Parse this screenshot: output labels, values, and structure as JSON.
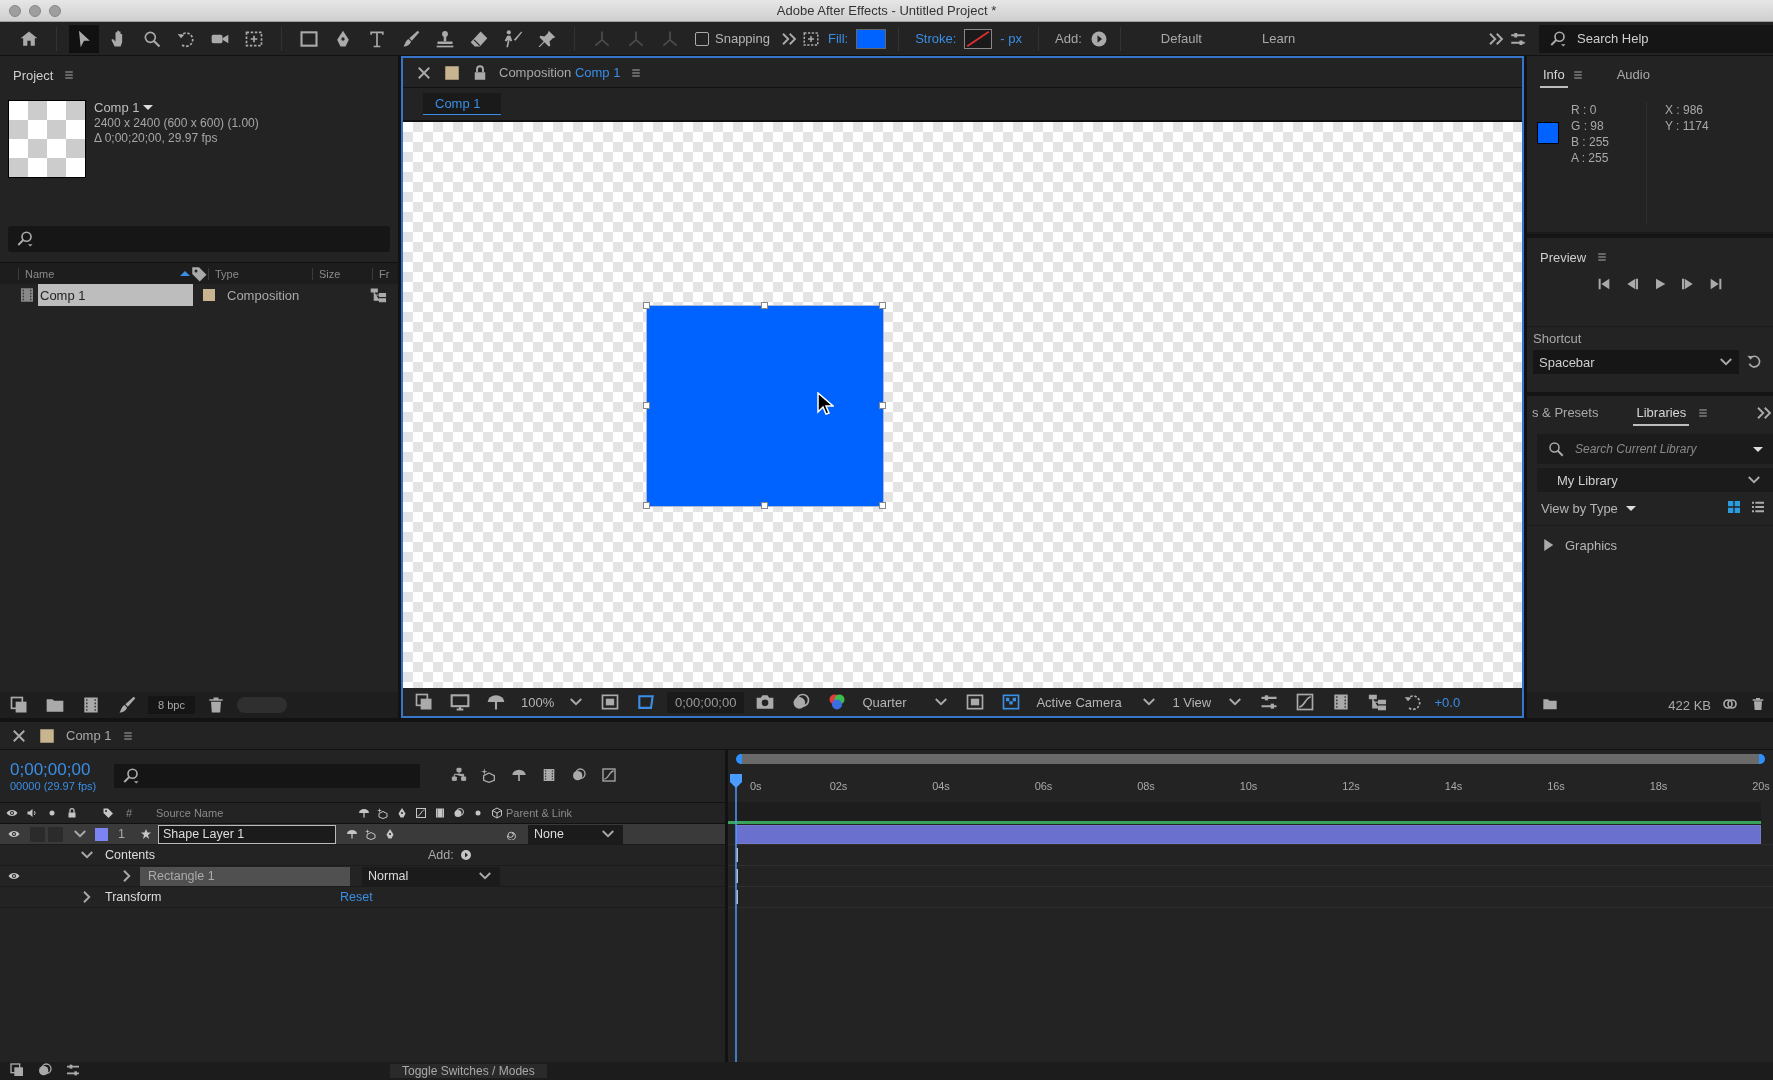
{
  "window": {
    "title": "Adobe After Effects - Untitled Project *"
  },
  "toolbar": {
    "tools": [
      {
        "kind": "home",
        "selected": false
      },
      {
        "kind": "select",
        "selected": true
      },
      {
        "kind": "hand",
        "selected": false
      },
      {
        "kind": "zoom",
        "selected": false
      },
      {
        "kind": "rotate",
        "selected": false
      },
      {
        "kind": "camera",
        "selected": false
      },
      {
        "kind": "pan",
        "selected": false
      },
      {
        "kind": "rectangle",
        "selected": false
      },
      {
        "kind": "pen",
        "selected": false
      },
      {
        "kind": "type",
        "selected": false
      },
      {
        "kind": "brush",
        "selected": false
      },
      {
        "kind": "stamp",
        "selected": false
      },
      {
        "kind": "eraser",
        "selected": false
      },
      {
        "kind": "roto",
        "selected": false
      },
      {
        "kind": "pin",
        "selected": false
      }
    ],
    "axis_modes": [
      {
        "disabled": true
      },
      {
        "disabled": true
      },
      {
        "disabled": true
      }
    ],
    "snapping": {
      "label": "Snapping",
      "checked": false
    },
    "fill_label": "Fill:",
    "stroke_label": "Stroke:",
    "stroke_width": "- px",
    "add_label": "Add:",
    "workspaces": [
      "Default",
      "Learn"
    ],
    "search": {
      "placeholder": "Search Help"
    }
  },
  "project": {
    "title": "Project",
    "comp_name": "Comp 1",
    "comp_size": "2400 x 2400  (600 x 600) (1.00)",
    "comp_duration": "Δ 0;00;20;00, 29.97 fps",
    "columns": [
      "Name",
      "Type",
      "Size",
      "Fr"
    ],
    "items": [
      {
        "name": "Comp 1",
        "type": "Composition",
        "selected": true
      }
    ],
    "bpc": "8 bpc"
  },
  "viewer": {
    "tab_label": "Composition",
    "tab_comp": "Comp 1",
    "breadcrumb": "Comp 1",
    "zoom": "100%",
    "timecode": "0;00;00;00",
    "resolution": "Quarter",
    "camera": "Active Camera",
    "views": "1 View",
    "exposure": "+0.0"
  },
  "info": {
    "tabs": [
      {
        "label": "Info",
        "selected": true
      },
      {
        "label": "Audio",
        "selected": false
      }
    ],
    "channels": [
      "R : 0",
      "G : 98",
      "B : 255",
      "A : 255"
    ],
    "coords": [
      "X : 986",
      "Y : 1174"
    ]
  },
  "preview": {
    "title": "Preview",
    "shortcut_label": "Shortcut",
    "shortcut": "Spacebar"
  },
  "libraries": {
    "tabs": [
      {
        "label": "s & Presets",
        "selected": false
      },
      {
        "label": "Libraries",
        "selected": true
      }
    ],
    "search": {
      "placeholder": "Search Current Library"
    },
    "library": "My Library",
    "view": "View by Type",
    "sections": [
      {
        "label": "Graphics",
        "expanded": false
      }
    ],
    "size": "422 KB"
  },
  "timeline": {
    "title": "Comp 1",
    "timecode": "0;00;00;00",
    "frame": "00000 (29.97 fps)",
    "columns": {
      "number": "#",
      "source": "Source Name",
      "parent": "Parent & Link"
    },
    "ruler": [
      "0s",
      "02s",
      "04s",
      "06s",
      "08s",
      "10s",
      "12s",
      "14s",
      "16s",
      "18s",
      "20s"
    ],
    "layers": [
      {
        "number": "1",
        "name": "Shape Layer 1",
        "visible": true,
        "expanded": true,
        "selected": true,
        "parent": "None",
        "color": "#7b84f2",
        "children": [
          {
            "name": "Contents",
            "expanded": true,
            "add_label": "Add:",
            "children": [
              {
                "name": "Rectangle 1",
                "expanded": false,
                "visible": true,
                "selected": true,
                "mode": "Normal"
              }
            ]
          },
          {
            "name": "Transform",
            "expanded": false,
            "action": "Reset"
          }
        ]
      }
    ],
    "toggle_label": "Toggle Switches / Modes"
  }
}
